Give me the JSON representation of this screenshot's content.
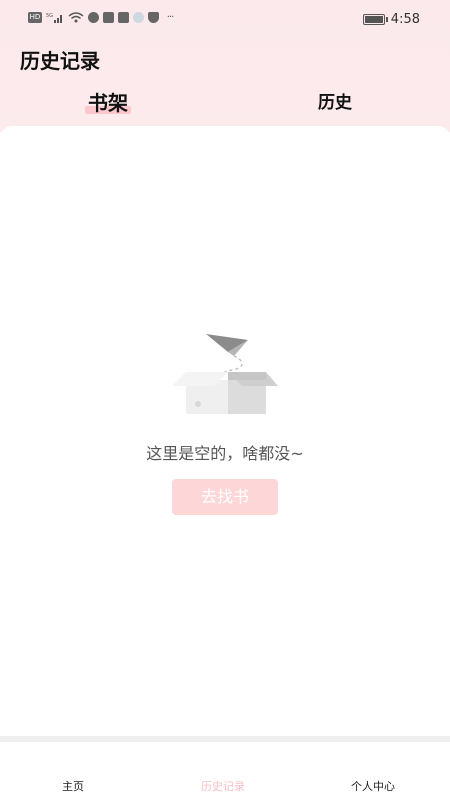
{
  "status_bar": {
    "time": "4:58",
    "icons": [
      "hd-icon",
      "5g-signal-icon",
      "wifi-icon",
      "app-icon",
      "mail-icon",
      "mail-icon",
      "notification-icon",
      "shield-icon",
      "more-icon",
      "battery-icon"
    ],
    "hd_label": "HD",
    "more_label": "···"
  },
  "header": {
    "title": "历史记录"
  },
  "tabs": [
    {
      "label": "书架",
      "active": true
    },
    {
      "label": "历史",
      "active": false
    }
  ],
  "empty_state": {
    "message": "这里是空的，啥都没~",
    "button_label": "去找书",
    "illustration": "empty-box-paper-plane-icon"
  },
  "colors": {
    "header_bg": "#fbe9eb",
    "tab_highlight": "#f9c7cc",
    "button_bg": "#fdd6d7",
    "nav_active": "#f7c1c6"
  },
  "bottom_nav": [
    {
      "label": "主页",
      "active": false
    },
    {
      "label": "历史记录",
      "active": true
    },
    {
      "label": "个人中心",
      "active": false
    }
  ]
}
